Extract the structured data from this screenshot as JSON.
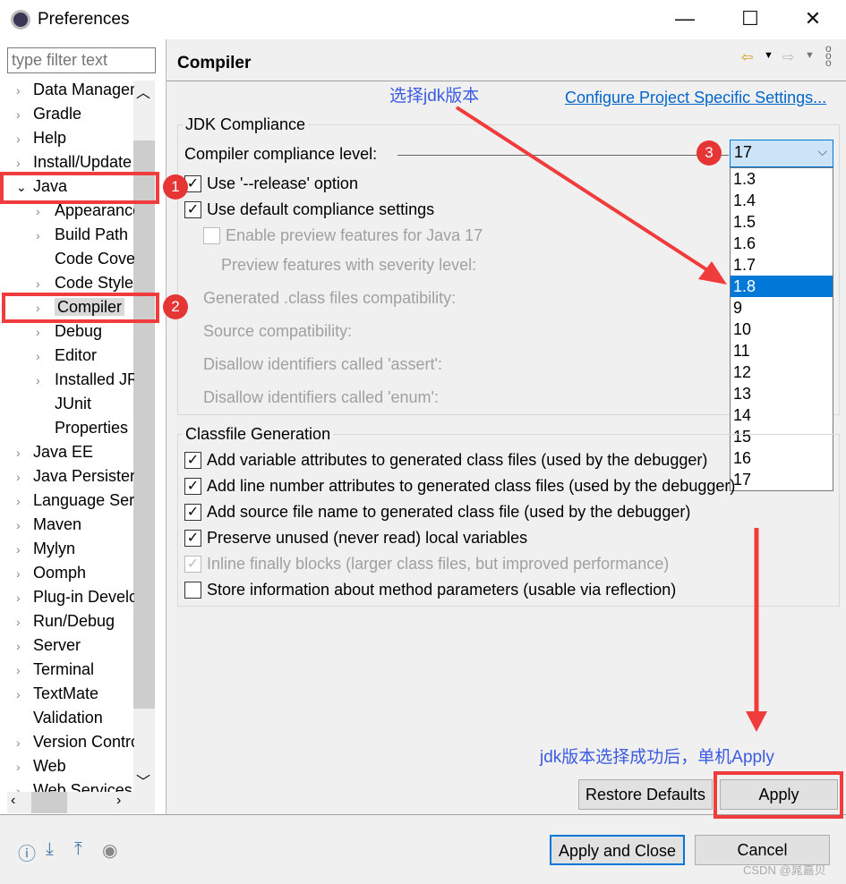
{
  "window": {
    "title": "Preferences",
    "minimize": "—",
    "maximize": "☐",
    "close": "✕"
  },
  "filter": {
    "placeholder": "type filter text"
  },
  "tree": [
    {
      "label": "Data Management",
      "level": 0,
      "arrow": "›"
    },
    {
      "label": "Gradle",
      "level": 0,
      "arrow": "›"
    },
    {
      "label": "Help",
      "level": 0,
      "arrow": "›"
    },
    {
      "label": "Install/Update",
      "level": 0,
      "arrow": "›"
    },
    {
      "label": "Java",
      "level": 0,
      "arrow": "⌄"
    },
    {
      "label": "Appearance",
      "level": 1,
      "arrow": "›"
    },
    {
      "label": "Build Path",
      "level": 1,
      "arrow": "›"
    },
    {
      "label": "Code Coverage",
      "level": 1,
      "arrow": ""
    },
    {
      "label": "Code Style",
      "level": 1,
      "arrow": "›"
    },
    {
      "label": "Compiler",
      "level": 1,
      "arrow": "›",
      "selected": true
    },
    {
      "label": "Debug",
      "level": 1,
      "arrow": "›"
    },
    {
      "label": "Editor",
      "level": 1,
      "arrow": "›"
    },
    {
      "label": "Installed JREs",
      "level": 1,
      "arrow": "›"
    },
    {
      "label": "JUnit",
      "level": 1,
      "arrow": ""
    },
    {
      "label": "Properties",
      "level": 1,
      "arrow": ""
    },
    {
      "label": "Java EE",
      "level": 0,
      "arrow": "›"
    },
    {
      "label": "Java Persistence",
      "level": 0,
      "arrow": "›"
    },
    {
      "label": "Language Servers",
      "level": 0,
      "arrow": "›"
    },
    {
      "label": "Maven",
      "level": 0,
      "arrow": "›"
    },
    {
      "label": "Mylyn",
      "level": 0,
      "arrow": "›"
    },
    {
      "label": "Oomph",
      "level": 0,
      "arrow": "›"
    },
    {
      "label": "Plug-in Development",
      "level": 0,
      "arrow": "›"
    },
    {
      "label": "Run/Debug",
      "level": 0,
      "arrow": "›"
    },
    {
      "label": "Server",
      "level": 0,
      "arrow": "›"
    },
    {
      "label": "Terminal",
      "level": 0,
      "arrow": "›"
    },
    {
      "label": "TextMate",
      "level": 0,
      "arrow": "›"
    },
    {
      "label": "Validation",
      "level": 0,
      "arrow": ""
    },
    {
      "label": "Version Control",
      "level": 0,
      "arrow": "›"
    },
    {
      "label": "Web",
      "level": 0,
      "arrow": "›"
    },
    {
      "label": "Web Services",
      "level": 0,
      "arrow": "›"
    }
  ],
  "page": {
    "title": "Compiler",
    "link": "Configure Project Specific Settings...",
    "jdk": {
      "group": "JDK Compliance",
      "level_label": "Compiler compliance level:",
      "level_value": "17",
      "options": [
        "1.3",
        "1.4",
        "1.5",
        "1.6",
        "1.7",
        "1.8",
        "9",
        "10",
        "11",
        "12",
        "13",
        "14",
        "15",
        "16",
        "17"
      ],
      "highlighted": "1.8",
      "release": "Use '--release' option",
      "default": "Use default compliance settings",
      "preview": "Enable preview features for Java 17",
      "severity": "Preview features with severity level:",
      "generated": "Generated .class files compatibility:",
      "source": "Source compatibility:",
      "assert": "Disallow identifiers called 'assert':",
      "enum": "Disallow identifiers called 'enum':"
    },
    "classfile": {
      "group": "Classfile Generation",
      "items": [
        {
          "label": "Add variable attributes to generated class files (used by the debugger)",
          "checked": true,
          "disabled": false
        },
        {
          "label": "Add line number attributes to generated class files (used by the debugger)",
          "checked": true,
          "disabled": false
        },
        {
          "label": "Add source file name to generated class file (used by the debugger)",
          "checked": true,
          "disabled": false
        },
        {
          "label": "Preserve unused (never read) local variables",
          "checked": true,
          "disabled": false
        },
        {
          "label": "Inline finally blocks (larger class files, but improved performance)",
          "checked": true,
          "disabled": true
        },
        {
          "label": "Store information about method parameters (usable via reflection)",
          "checked": false,
          "disabled": false
        }
      ]
    },
    "restore": "Restore Defaults",
    "apply": "Apply"
  },
  "footer": {
    "apply_close": "Apply and Close",
    "cancel": "Cancel"
  },
  "annotations": {
    "b1": "1",
    "b2": "2",
    "b3": "3",
    "note_top": "选择jdk版本",
    "note_bottom": "jdk版本选择成功后，单机Apply",
    "watermark": "CSDN @晁嘉贝"
  },
  "colors": {
    "accent": "#0078d7",
    "annotation_red": "#f03c3c",
    "annotation_text": "#3c5be0"
  }
}
